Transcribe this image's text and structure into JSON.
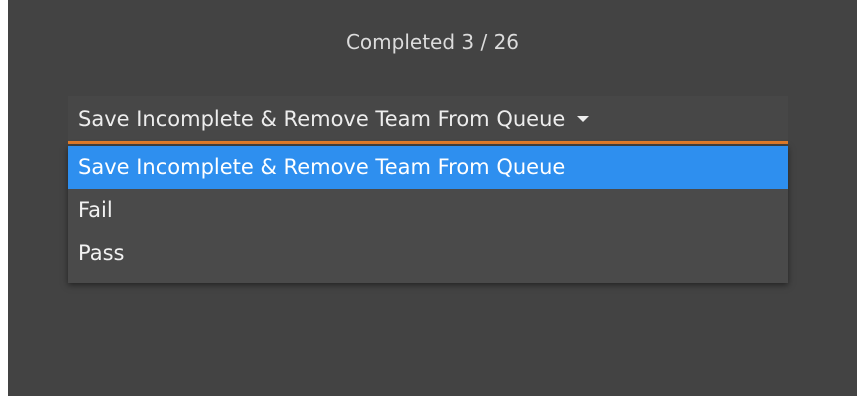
{
  "progress": {
    "text": "Completed 3 / 26",
    "completed": 3,
    "total": 26
  },
  "dropdown": {
    "selected": "Save Incomplete & Remove Team From Queue",
    "icon": "caret-down-icon",
    "options": [
      "Save Incomplete & Remove Team From Queue",
      "Fail",
      "Pass"
    ]
  },
  "colors": {
    "background": "#434343",
    "accent_underline": "#e07b2a",
    "highlight": "#2e8fef"
  }
}
